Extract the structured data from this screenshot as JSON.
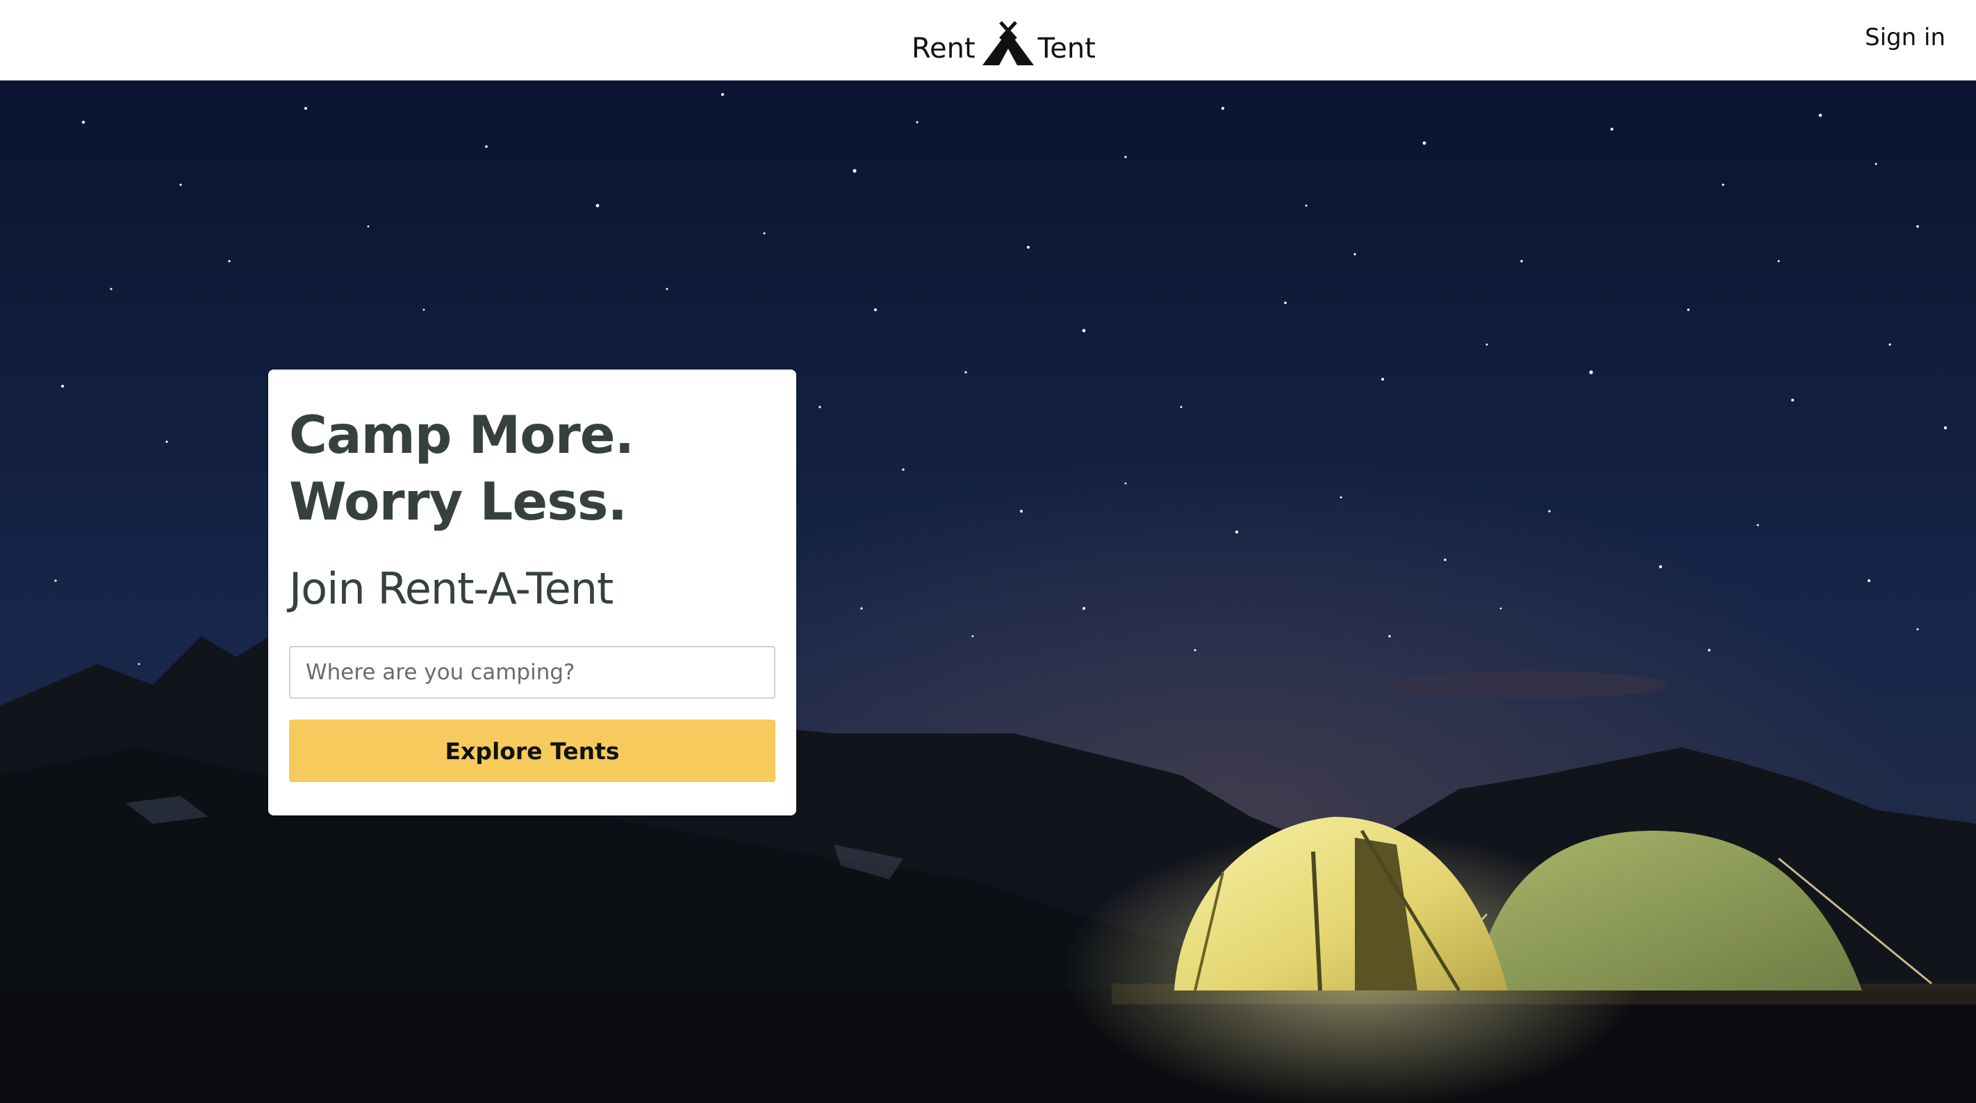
{
  "header": {
    "logo_left": "Rent",
    "logo_icon": "tent-icon",
    "logo_right": "Tent",
    "signin_label": "Sign in"
  },
  "hero": {
    "background": "starry-night-camping-photo",
    "card": {
      "headline_line1": "Camp More.",
      "headline_line2": "Worry Less.",
      "subheadline": "Join Rent-A-Tent",
      "search_placeholder": "Where are you camping?",
      "search_value": "",
      "button_label": "Explore Tents"
    }
  },
  "colors": {
    "accent": "#f6ca5c",
    "heading": "#36413e",
    "sky_top": "#0c1630",
    "sky_bottom": "#1c2a4a",
    "tent_glow": "#f2ea8a"
  }
}
